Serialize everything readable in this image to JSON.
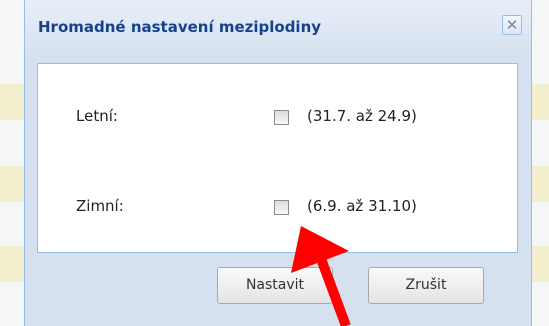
{
  "dialog": {
    "title": "Hromadné nastavení meziplodiny",
    "close_label": "✕",
    "rows": [
      {
        "label": "Letní:",
        "range": "(31.7. až 24.9)",
        "checked": false
      },
      {
        "label": "Zimní:",
        "range": "(6.9. až 31.10)",
        "checked": false
      }
    ],
    "buttons": {
      "set": "Nastavit",
      "cancel": "Zrušit"
    }
  },
  "annotation": {
    "arrow_color": "#ff0000"
  },
  "colors": {
    "title_text": "#15428b",
    "dialog_frame": "#d6e1ef",
    "border": "#99bbe8"
  }
}
